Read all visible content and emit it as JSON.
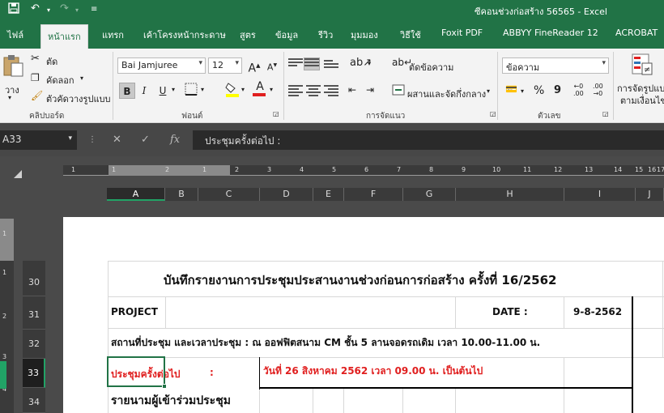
{
  "app": {
    "window_title": "ซีคอนช่วงก่อสร้าง 56565  -  Excel"
  },
  "colors": {
    "accent": "#217346",
    "red_text": "#e01f1f",
    "ruler_text": "#dddddd"
  },
  "ribbon_tabs": [
    "ไฟล์",
    "หน้าแรก",
    "แทรก",
    "เค้าโครงหน้ากระดาษ",
    "สูตร",
    "ข้อมูล",
    "รีวิว",
    "มุมมอง",
    "วิธีใช้",
    "Foxit PDF",
    "ABBYY FineReader 12",
    "ACROBAT"
  ],
  "ribbon": {
    "clipboard": {
      "paste": "วาง",
      "cut": "ตัด",
      "copy": "คัดลอก",
      "format_painter": "ตัวคัดวางรูปแบบ",
      "label": "คลิปบอร์ด"
    },
    "font": {
      "name": "Bai Jamjuree",
      "size": "12",
      "grow": "A",
      "shrink": "A",
      "bold": "B",
      "italic": "I",
      "underline": "U",
      "font_color": "A",
      "label": "ฟอนต์"
    },
    "alignment": {
      "wrap": "ตัดข้อความ",
      "merge": "ผสานและจัดกึ่งกลาง",
      "label": "การจัดแนว"
    },
    "number": {
      "format": "ข้อความ",
      "percent": "%",
      "comma": "9",
      "inc_decimal": ".00",
      "dec_decimal": ".00",
      "label": "ตัวเลข"
    },
    "styles": {
      "conditional_line1": "การจัดรูปแบบ",
      "conditional_line2": "ตามเงื่อนไข"
    }
  },
  "formula_bar": {
    "name_box": "A33",
    "cancel": "✕",
    "enter": "✓",
    "fx": "fx",
    "content": "ประชุมครั้งต่อไป        :"
  },
  "columns": [
    "A",
    "B",
    "C",
    "D",
    "E",
    "F",
    "G",
    "H",
    "I",
    "J"
  ],
  "ruler_marks": [
    "1",
    "1",
    "2",
    "1",
    "2",
    "3",
    "4",
    "5",
    "6",
    "7",
    "8",
    "9",
    "10",
    "11",
    "12",
    "13",
    "14",
    "15",
    "16",
    "17"
  ],
  "vruler_marks": [
    "1",
    "1",
    "2",
    "3",
    "4"
  ],
  "rows": [
    "30",
    "31",
    "32",
    "33",
    "34"
  ],
  "sheet": {
    "title": "บันทึกรายงานการประชุมประสานงานช่วงก่อนการก่อสร้าง ครั้งที่ 16/2562",
    "project_label": "PROJECT",
    "date_label": "DATE :",
    "date_value": "9-8-2562",
    "venue": "สถานที่ประชุม และเวลาประชุม   :   ณ ออฟฟิตสนาม CM  ชั้น 5 ลานจอดรถเดิม  เวลา 10.00-11.00 น.",
    "next_label": "ประชุมครั้งต่อไป",
    "next_colon": ":",
    "next_value": "วันที่ 26 สิงหาคม 2562 เวลา 09.00 น. เป็นต้นไป",
    "attendees": "รายนามผู้เข้าร่วมประชุม"
  }
}
